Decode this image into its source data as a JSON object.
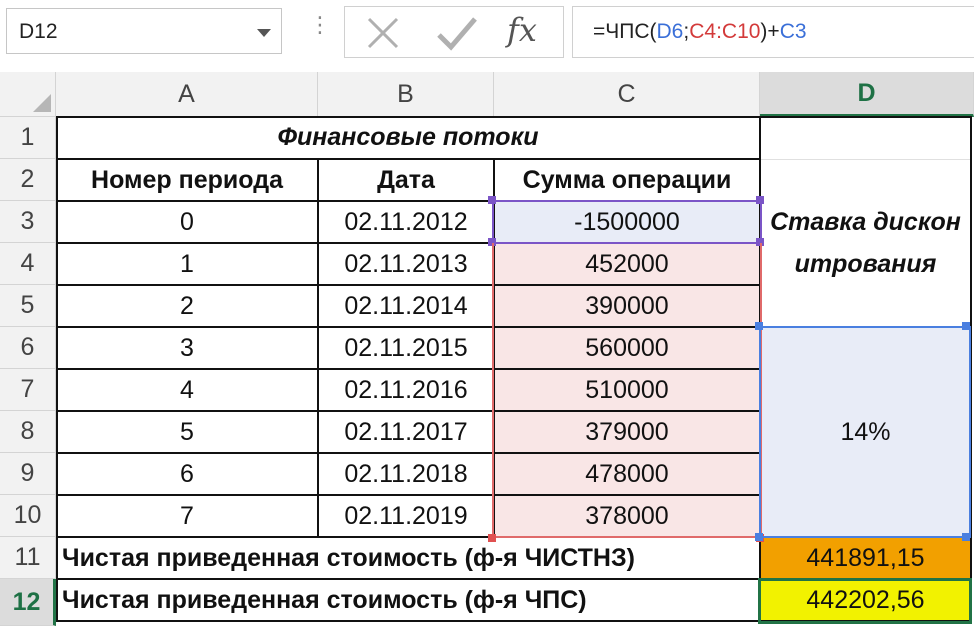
{
  "formula_bar": {
    "name_box": "D12",
    "vdots": "⋮",
    "fx_symbol": "fx",
    "formula_parts": [
      {
        "text": "=ЧПС(",
        "color": "default"
      },
      {
        "text": "D6",
        "color": "blue"
      },
      {
        "text": ";",
        "color": "default"
      },
      {
        "text": "C4:C10",
        "color": "red"
      },
      {
        "text": ")+",
        "color": "default"
      },
      {
        "text": "C3",
        "color": "blue"
      }
    ]
  },
  "columns": [
    "A",
    "B",
    "C",
    "D"
  ],
  "rows": [
    "1",
    "2",
    "3",
    "4",
    "5",
    "6",
    "7",
    "8",
    "9",
    "10",
    "11",
    "12"
  ],
  "active_cell": {
    "col": "D",
    "row": "12"
  },
  "sheet": {
    "title": "Финансовые потоки",
    "headers": {
      "period": "Номер периода",
      "date": "Дата",
      "amount": "Сумма операции"
    },
    "rate_label": "Ставка дисконитрования",
    "rate_value": "14%",
    "data_rows": [
      {
        "period": "0",
        "date": "02.11.2012",
        "amount": "-1500000"
      },
      {
        "period": "1",
        "date": "02.11.2013",
        "amount": "452000"
      },
      {
        "period": "2",
        "date": "02.11.2014",
        "amount": "390000"
      },
      {
        "period": "3",
        "date": "02.11.2015",
        "amount": "560000"
      },
      {
        "period": "4",
        "date": "02.11.2016",
        "amount": "510000"
      },
      {
        "period": "5",
        "date": "02.11.2017",
        "amount": "379000"
      },
      {
        "period": "6",
        "date": "02.11.2018",
        "amount": "478000"
      },
      {
        "period": "7",
        "date": "02.11.2019",
        "amount": "378000"
      }
    ],
    "result_xnpv": {
      "label": "Чистая приведенная стоимость (ф-я ЧИСТНЗ)",
      "value": "441891,15"
    },
    "result_npv": {
      "label": "Чистая приведенная стоимость (ф-я ЧПС)",
      "value": "442202,56"
    }
  },
  "colors": {
    "ref_blue": "#3a6fd8",
    "ref_red": "#d33a3a",
    "xnpv_fill": "#f2a000",
    "npv_fill": "#f2f200",
    "active_green": "#217346"
  }
}
